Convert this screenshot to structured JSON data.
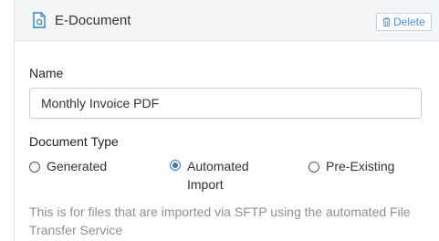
{
  "header": {
    "title": "E-Document",
    "delete_label": "Delete"
  },
  "form": {
    "name_label": "Name",
    "name_value": "Monthly Invoice PDF",
    "document_type_label": "Document Type",
    "document_type_options": [
      {
        "label": "Generated",
        "selected": false
      },
      {
        "label": "Automated Import",
        "selected": true
      },
      {
        "label": "Pre-Existing",
        "selected": false
      }
    ],
    "help_text": "This is for files that are imported via SFTP using the automated File Transfer Service"
  },
  "colors": {
    "accent": "#2f7fd8",
    "header_bg": "#f4f5f7",
    "help_text": "#8a9099"
  },
  "icons": {
    "document": "document-icon",
    "delete": "trash-icon"
  }
}
